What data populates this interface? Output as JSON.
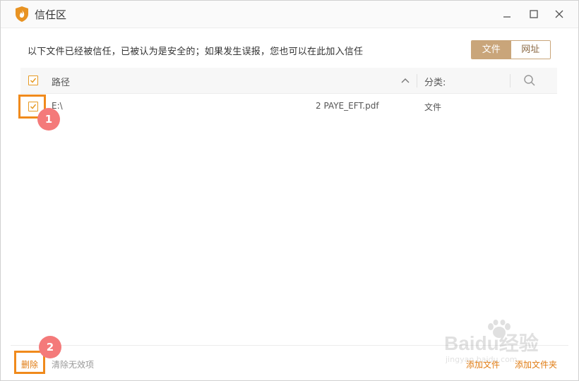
{
  "window": {
    "title": "信任区"
  },
  "header": {
    "description": "以下文件已经被信任，已被认为是安全的；如果发生误报，您也可以在此加入信任",
    "tabs": [
      {
        "label": "文件",
        "active": true
      },
      {
        "label": "网址",
        "active": false
      }
    ]
  },
  "table": {
    "columns": {
      "path": "路径",
      "category": "分类:"
    },
    "rows": [
      {
        "checked": true,
        "path_start": "E:\\",
        "path_end": "2 PAYE_EFT.pdf",
        "category": "文件"
      }
    ]
  },
  "annotations": {
    "marker1": "1",
    "marker2": "2"
  },
  "footer": {
    "delete_label": "删除",
    "clear_label": "清除无效项",
    "add_file_label": "添加文件",
    "add_folder_label": "添加文件夹"
  },
  "watermark": {
    "logo_text": "Baidu经验",
    "url_text": "jingyan.baidu.com"
  },
  "colors": {
    "accent": "#c9a57a",
    "orange": "#e07b12",
    "checkbox": "#e69a24",
    "marker": "#f47a7a"
  }
}
